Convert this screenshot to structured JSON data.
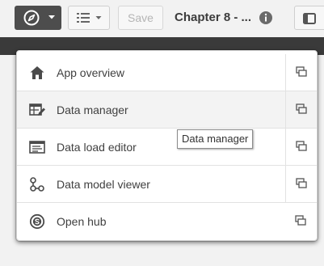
{
  "toolbar": {
    "navigation_icon": "compass-icon",
    "sheets_icon": "list-icon",
    "save_label": "Save",
    "app_title": "Chapter 8 - ...",
    "info_icon": "info-icon",
    "right_icon": "bookmark-icon"
  },
  "menu": {
    "items": [
      {
        "label": "App overview",
        "icon": "home-icon",
        "open_new_tab_icon": "new-tab-icon"
      },
      {
        "label": "Data manager",
        "icon": "data-manager-icon",
        "open_new_tab_icon": "new-tab-icon"
      },
      {
        "label": "Data load editor",
        "icon": "script-editor-icon",
        "open_new_tab_icon": "new-tab-icon"
      },
      {
        "label": "Data model viewer",
        "icon": "data-model-icon",
        "open_new_tab_icon": "new-tab-icon"
      },
      {
        "label": "Open hub",
        "icon": "hub-icon",
        "open_new_tab_icon": "new-tab-icon"
      }
    ]
  },
  "tooltip": {
    "text": "Data manager"
  },
  "colors": {
    "toolbar_bg": "#f2f2f2",
    "nav_button_bg": "#4d4d4d",
    "dark_strip": "#3a3a3a",
    "menu_bg": "#ffffff",
    "hover_row": "#f3f3f3",
    "text": "#404040"
  }
}
